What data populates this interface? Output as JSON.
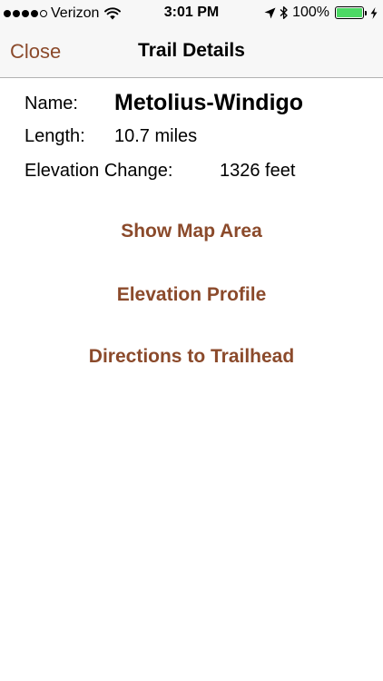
{
  "status_bar": {
    "carrier": "Verizon",
    "time": "3:01 PM",
    "battery_percent": "100%",
    "battery_level": 1.0,
    "signal_bars_filled": 4,
    "signal_bars_total": 5,
    "battery_color": "#4cd964",
    "icons": [
      "signal-dots-icon",
      "wifi-icon",
      "location-arrow-icon",
      "bluetooth-icon",
      "battery-icon",
      "charging-bolt-icon"
    ]
  },
  "nav": {
    "close_label": "Close",
    "title": "Trail Details",
    "accent_color": "#8b4a2b"
  },
  "details": {
    "name_label": "Name:",
    "name_value": "Metolius-Windigo",
    "length_label": "Length:",
    "length_value": "10.7 miles",
    "elevation_label": "Elevation Change:",
    "elevation_value": "1326 feet"
  },
  "actions": {
    "show_map": "Show Map Area",
    "elevation_profile": "Elevation Profile",
    "directions": "Directions to Trailhead"
  }
}
